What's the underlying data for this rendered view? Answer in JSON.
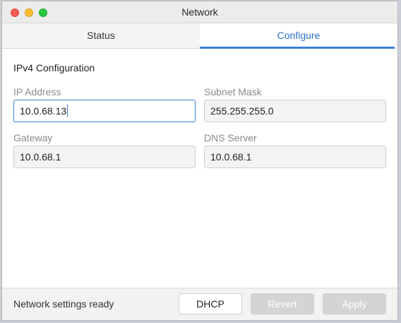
{
  "window": {
    "title": "Network"
  },
  "tabs": [
    {
      "label": "Status",
      "active": false
    },
    {
      "label": "Configure",
      "active": true
    }
  ],
  "section": {
    "title": "IPv4 Configuration"
  },
  "fields": {
    "ip_address": {
      "label": "IP Address",
      "value": "10.0.68.13"
    },
    "subnet_mask": {
      "label": "Subnet Mask",
      "value": "255.255.255.0"
    },
    "gateway": {
      "label": "Gateway",
      "value": "10.0.68.1"
    },
    "dns_server": {
      "label": "DNS Server",
      "value": "10.0.68.1"
    }
  },
  "footer": {
    "status": "Network settings ready",
    "dhcp_label": "DHCP",
    "revert_label": "Revert",
    "apply_label": "Apply"
  },
  "colors": {
    "accent": "#3b7dd8",
    "close": "#ff5f57",
    "minimize": "#febc2e",
    "maximize": "#28c840",
    "disabled_button": "#d4d4d4"
  }
}
